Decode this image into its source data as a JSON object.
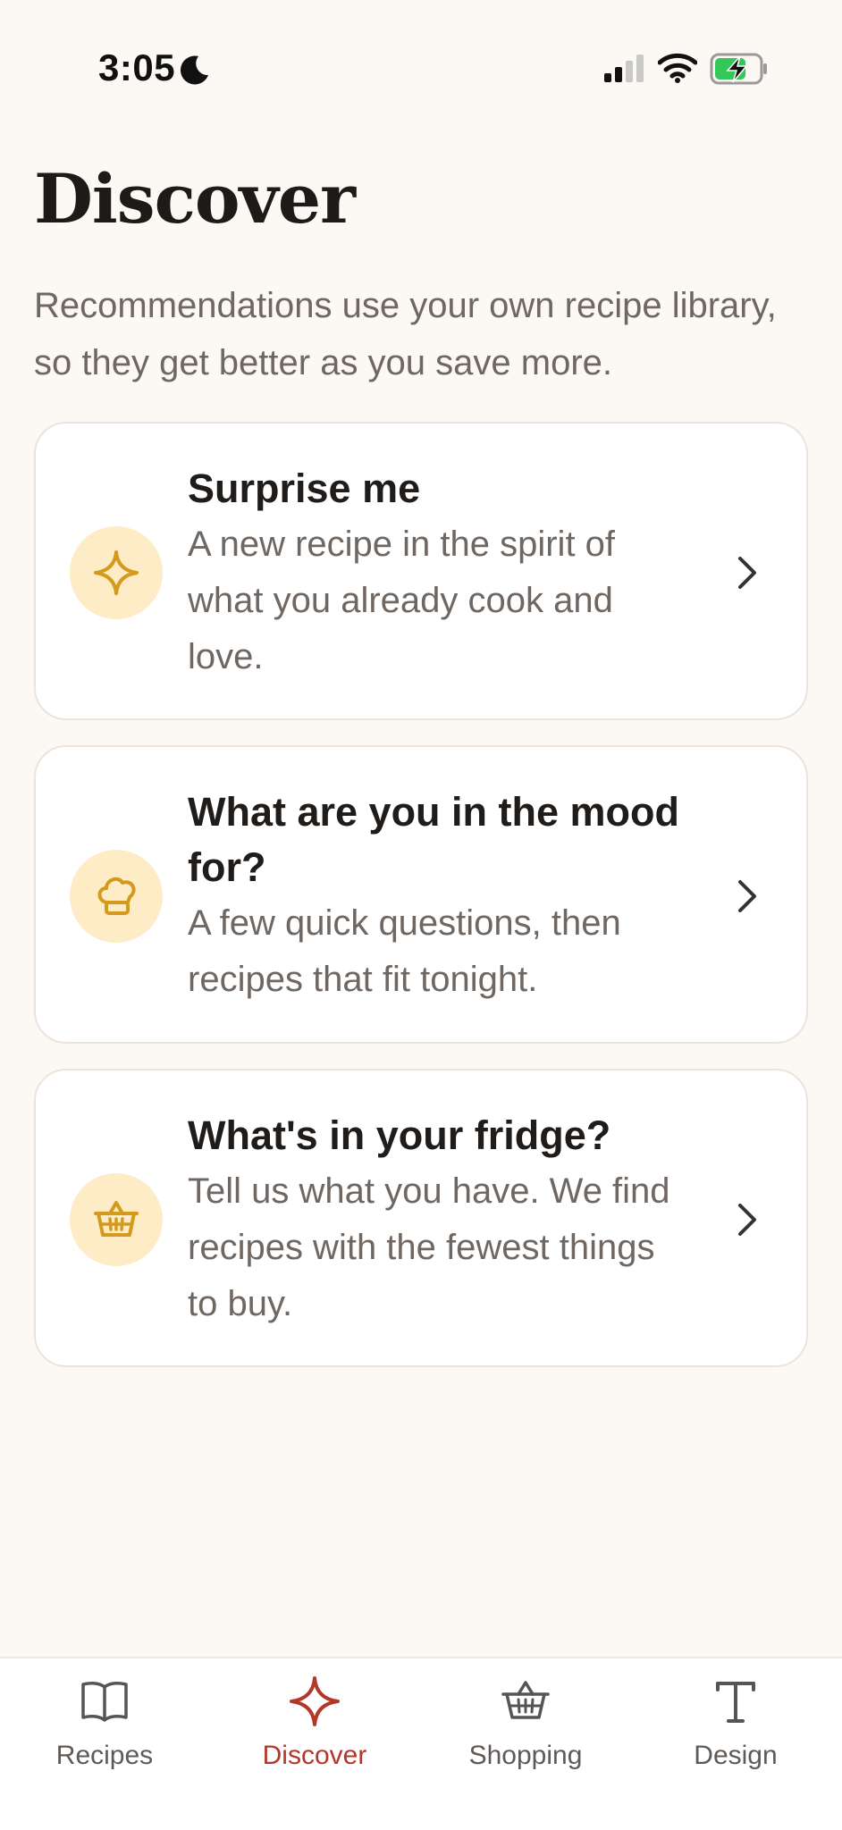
{
  "status_bar": {
    "time": "3:05"
  },
  "header": {
    "title": "Discover",
    "subtitle": "Recommendations use your own recipe library, so they get better as you save more."
  },
  "cards": [
    {
      "icon": "sparkle-icon",
      "title": "Surprise me",
      "description": "A new recipe in the spirit of what you already cook and love."
    },
    {
      "icon": "chef-hat-icon",
      "title": "What are you in the mood for?",
      "description": "A few quick questions, then recipes that fit tonight."
    },
    {
      "icon": "basket-icon",
      "title": "What's in your fridge?",
      "description": "Tell us what you have. We find recipes with the fewest things to buy."
    }
  ],
  "tab_bar": {
    "tabs": [
      {
        "label": "Recipes",
        "icon": "book-icon",
        "active": false
      },
      {
        "label": "Discover",
        "icon": "sparkle-icon",
        "active": true
      },
      {
        "label": "Shopping",
        "icon": "basket-icon",
        "active": false
      },
      {
        "label": "Design",
        "icon": "text-icon",
        "active": false
      }
    ]
  },
  "colors": {
    "background": "#fcf8f3",
    "accent": "#b3382a",
    "icon_gold": "#d49a1e",
    "icon_bg": "#fdecc5"
  }
}
